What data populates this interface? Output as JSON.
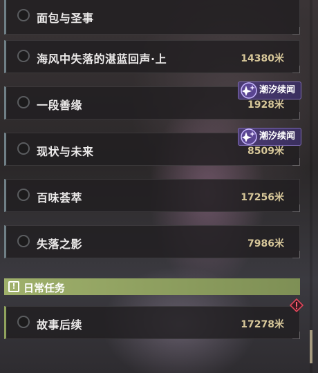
{
  "quests": [
    {
      "title": "面包与圣事",
      "distance": "",
      "badge": ""
    },
    {
      "title": "海风中失落的湛蓝回声·上",
      "distance": "14380米",
      "badge": ""
    },
    {
      "title": "一段善缘",
      "distance": "1928米",
      "badge": "潮汐续闻"
    },
    {
      "title": "现状与未来",
      "distance": "8509米",
      "badge": "潮汐续闻"
    },
    {
      "title": "百味荟萃",
      "distance": "17256米",
      "badge": ""
    },
    {
      "title": "失落之影",
      "distance": "7986米",
      "badge": ""
    }
  ],
  "section": {
    "label": "日常任务",
    "icon": "exclamation-box-icon"
  },
  "daily_quests": [
    {
      "title": "故事后续",
      "distance": "17278米",
      "alert": "diamond-alert-icon"
    }
  ],
  "colors": {
    "badge_bg": "#4b3b73",
    "section_bg": "#9fb06b",
    "distance_text": "#d8c89a",
    "alert": "#e0465a"
  }
}
